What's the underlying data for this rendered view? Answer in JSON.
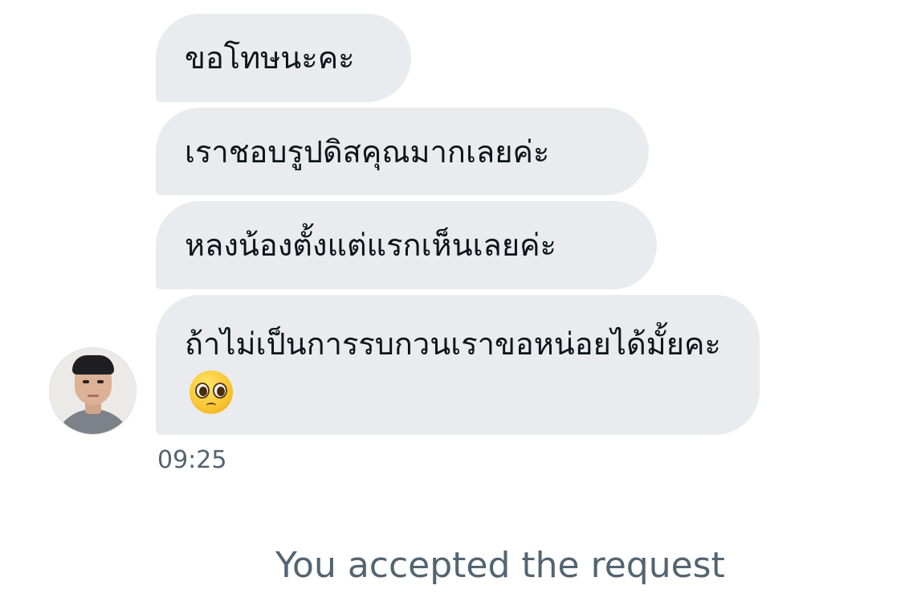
{
  "conversation": {
    "messages": [
      {
        "text": "ขอโทษนะคะ"
      },
      {
        "text": "เราชอบรูปดิสคุณมากเลยค่ะ"
      },
      {
        "text": "หลงน้องตั้งแต่แรกเห็นเลยค่ะ"
      },
      {
        "text": "ถ้าไม่เป็นการรบกวนเราขอหน่อยได้มั้ยคะ",
        "emoji": "pleading-face-emoji"
      }
    ],
    "sender_avatar_icon": "user-avatar",
    "timestamp": "09:25",
    "system_note": "You accepted the request"
  },
  "colors": {
    "bubble_background": "#e9ebef",
    "message_text": "#0f1419",
    "secondary_text": "#536471",
    "page_background": "#ffffff"
  }
}
